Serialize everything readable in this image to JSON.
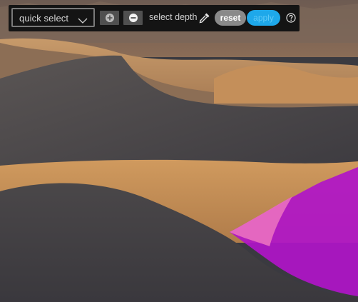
{
  "toolbar": {
    "mode_select": {
      "value": "quick select"
    },
    "add_icon": "plus-circle-icon",
    "subtract_icon": "minus-circle-icon",
    "depth_label": "select depth",
    "picker_icon": "eyedropper-icon",
    "reset_label": "reset",
    "apply_label": "apply",
    "help_icon": "question-circle-icon"
  },
  "colors": {
    "toolbar_bg": "#141414",
    "accent": "#1ea8ea",
    "selection_overlay": "#b015c8",
    "selection_edge": "#e76bc0"
  }
}
